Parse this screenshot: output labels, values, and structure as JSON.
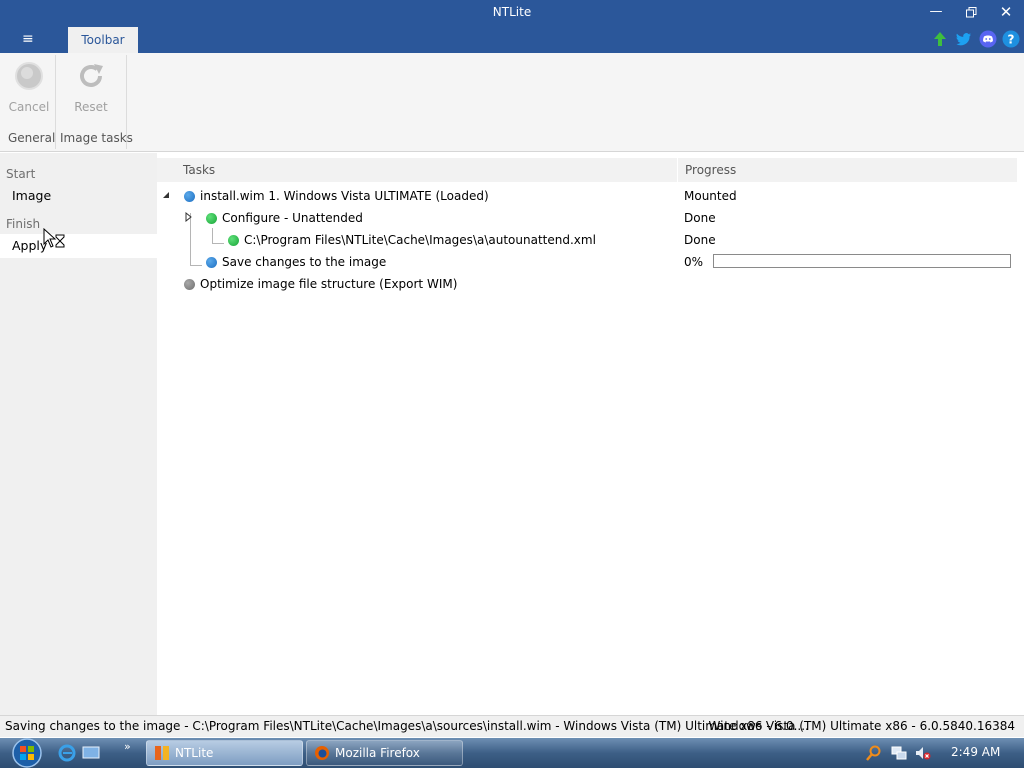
{
  "window": {
    "title": "NTLite",
    "minimize_icon": "minimize-icon",
    "restore_icon": "restore-icon",
    "close_icon": "close-icon"
  },
  "ribbon": {
    "menu_icon": "hamburger-menu-icon",
    "tab_label": "Toolbar",
    "top_icons": [
      "update-arrow-icon",
      "twitter-icon",
      "discord-icon",
      "help-icon"
    ],
    "buttons": [
      {
        "label": "Cancel",
        "icon": "cancel-circle-icon",
        "enabled": false
      },
      {
        "label": "Reset",
        "icon": "reset-refresh-icon",
        "enabled": false
      }
    ],
    "groups": [
      {
        "label": "General"
      },
      {
        "label": "Image tasks"
      }
    ]
  },
  "sidebar": {
    "sections": [
      {
        "heading": "Start",
        "items": [
          {
            "label": "Image",
            "active": false
          }
        ]
      },
      {
        "heading": "Finish",
        "items": [
          {
            "label": "Apply",
            "active": true
          }
        ]
      }
    ]
  },
  "tasks": {
    "columns": {
      "tasks": "Tasks",
      "progress": "Progress"
    },
    "rows": [
      {
        "label": "install.wim 1. Windows Vista ULTIMATE  (Loaded)",
        "status": "Mounted",
        "dot": "blue",
        "level": 0,
        "expander": "expanded"
      },
      {
        "label": "Configure - Unattended",
        "status": "Done",
        "dot": "green",
        "level": 1,
        "expander": "collapsed"
      },
      {
        "label": "C:\\Program Files\\NTLite\\Cache\\Images\\a\\autounattend.xml",
        "status": "Done",
        "dot": "green",
        "level": 2,
        "expander": "none"
      },
      {
        "label": "Save changes to the image",
        "status": "0%",
        "dot": "blue",
        "level": 1,
        "expander": "none",
        "progress_fraction": 0
      },
      {
        "label": "Optimize image file structure (Export WIM)",
        "status": "",
        "dot": "gray",
        "level": 0,
        "expander": "none"
      }
    ]
  },
  "statusbar": {
    "left": "Saving changes to the image - C:\\Program Files\\NTLite\\Cache\\Images\\a\\sources\\install.wim - Windows Vista (TM) Ultimate x86 - 6.0....",
    "right": "Windows Vista (TM) Ultimate x86 - 6.0.5840.16384"
  },
  "taskbar": {
    "start_icon": "windows-start-orb-icon",
    "quick_launch": [
      "internet-explorer-icon",
      "show-desktop-icon",
      "quick-launch-overflow-icon"
    ],
    "buttons": [
      {
        "label": "NTLite",
        "icon": "ntlite-app-icon",
        "active": true
      },
      {
        "label": "Mozilla Firefox",
        "icon": "firefox-icon",
        "active": false
      }
    ],
    "tray_icons": [
      "search-magnifier-icon",
      "network-icon",
      "volume-muted-icon"
    ],
    "clock": "2:49 AM"
  },
  "colors": {
    "titlebar": "#2b579a",
    "dot_blue": "#1e6fc2",
    "dot_green": "#17a437",
    "dot_gray": "#6f6f6f"
  }
}
